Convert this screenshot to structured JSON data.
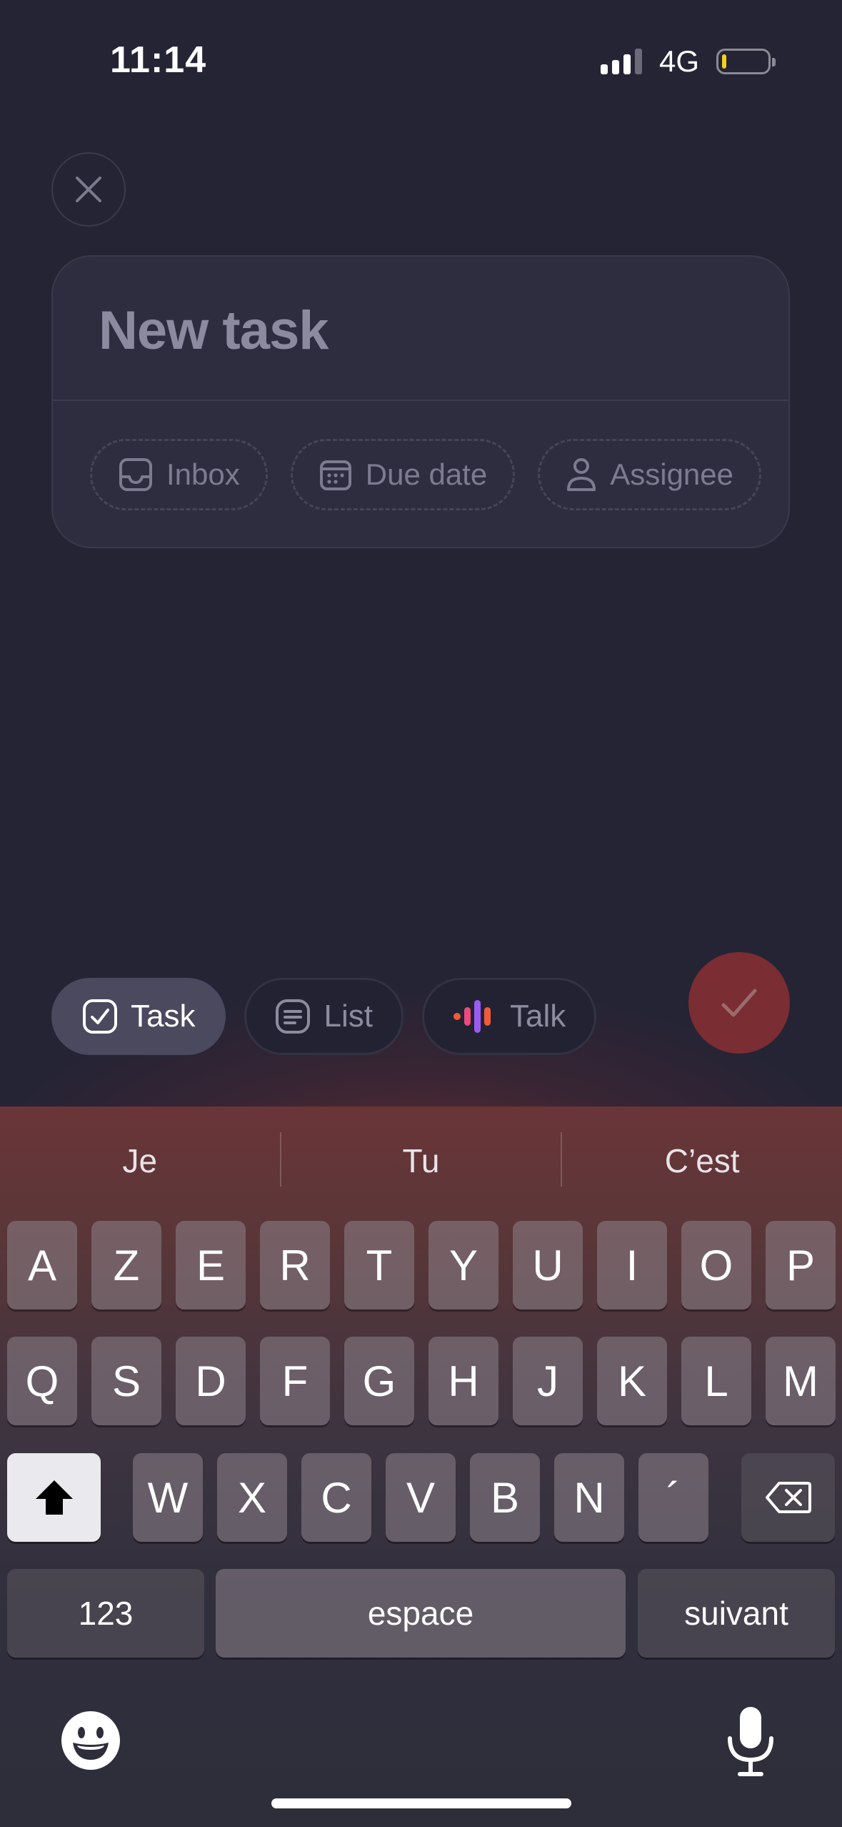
{
  "status_bar": {
    "time": "11:14",
    "network": "4G",
    "battery_level": 0.1,
    "battery_color": "#f2d21c"
  },
  "task_card": {
    "title_placeholder": "New task",
    "chips": [
      {
        "icon": "inbox-tray-icon",
        "label": "Inbox"
      },
      {
        "icon": "calendar-icon",
        "label": "Due date"
      },
      {
        "icon": "person-icon",
        "label": "Assignee"
      }
    ]
  },
  "modes": [
    {
      "icon": "checkbox-icon",
      "label": "Task",
      "active": true
    },
    {
      "icon": "list-icon",
      "label": "List",
      "active": false
    },
    {
      "icon": "voice-waveform-icon",
      "label": "Talk",
      "active": false
    }
  ],
  "confirm": {
    "icon": "checkmark-icon",
    "color": "#7a2d32"
  },
  "keyboard": {
    "suggestions": [
      "Je",
      "Tu",
      "C’est"
    ],
    "row1": [
      "A",
      "Z",
      "E",
      "R",
      "T",
      "Y",
      "U",
      "I",
      "O",
      "P"
    ],
    "row2": [
      "Q",
      "S",
      "D",
      "F",
      "G",
      "H",
      "J",
      "K",
      "L",
      "M"
    ],
    "row3": [
      "W",
      "X",
      "C",
      "V",
      "B",
      "N",
      "´"
    ],
    "numbers_label": "123",
    "space_label": "espace",
    "return_label": "suivant",
    "icons": [
      "shift-icon",
      "backspace-icon",
      "emoji-icon",
      "microphone-icon"
    ]
  }
}
